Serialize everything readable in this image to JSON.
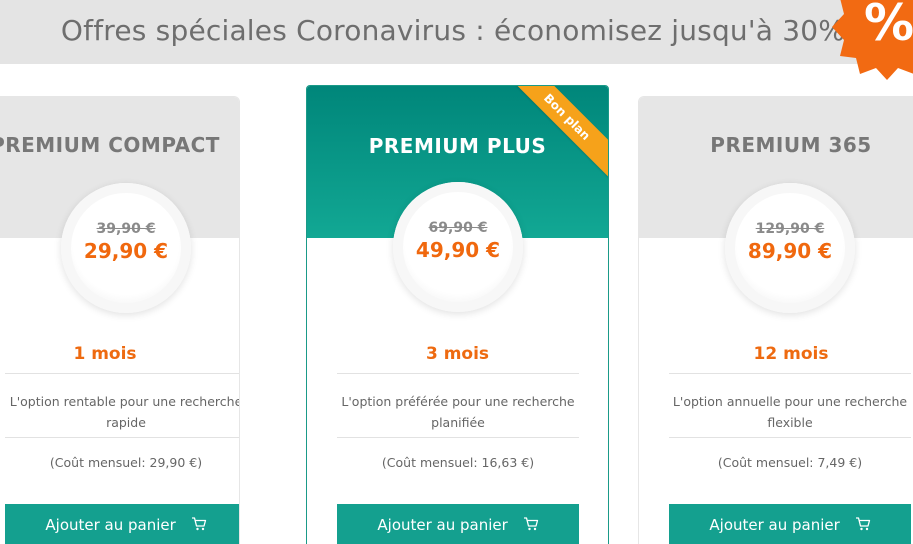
{
  "banner": {
    "title": "Offres spéciales Coronavirus : économisez jusqu'à 30%",
    "badge_symbol": "%",
    "badge_color": "#f26a12"
  },
  "colors": {
    "accent": "#14a08f",
    "price": "#f0680e",
    "ribbon": "#f6a21a"
  },
  "plans": [
    {
      "title": "PREMIUM COMPACT",
      "old_price": "39,90 €",
      "new_price": "29,90 €",
      "duration": "1 mois",
      "description": "L'option rentable pour une recherche rapide",
      "monthly": "(Coût mensuel: 29,90 €)",
      "button": "Ajouter au panier",
      "button_icon": "cart-icon"
    },
    {
      "title": "PREMIUM PLUS",
      "ribbon": "Bon plan",
      "old_price": "69,90 €",
      "new_price": "49,90 €",
      "duration": "3 mois",
      "description": "L'option préférée pour une recherche planifiée",
      "monthly": "(Coût mensuel: 16,63 €)",
      "button": "Ajouter au panier",
      "button_icon": "cart-icon"
    },
    {
      "title": "PREMIUM 365",
      "old_price": "129,90 €",
      "new_price": "89,90 €",
      "duration": "12 mois",
      "description": "L'option annuelle pour une recherche flexible",
      "monthly": "(Coût mensuel: 7,49 €)",
      "button": "Ajouter au panier",
      "button_icon": "cart-icon"
    }
  ]
}
